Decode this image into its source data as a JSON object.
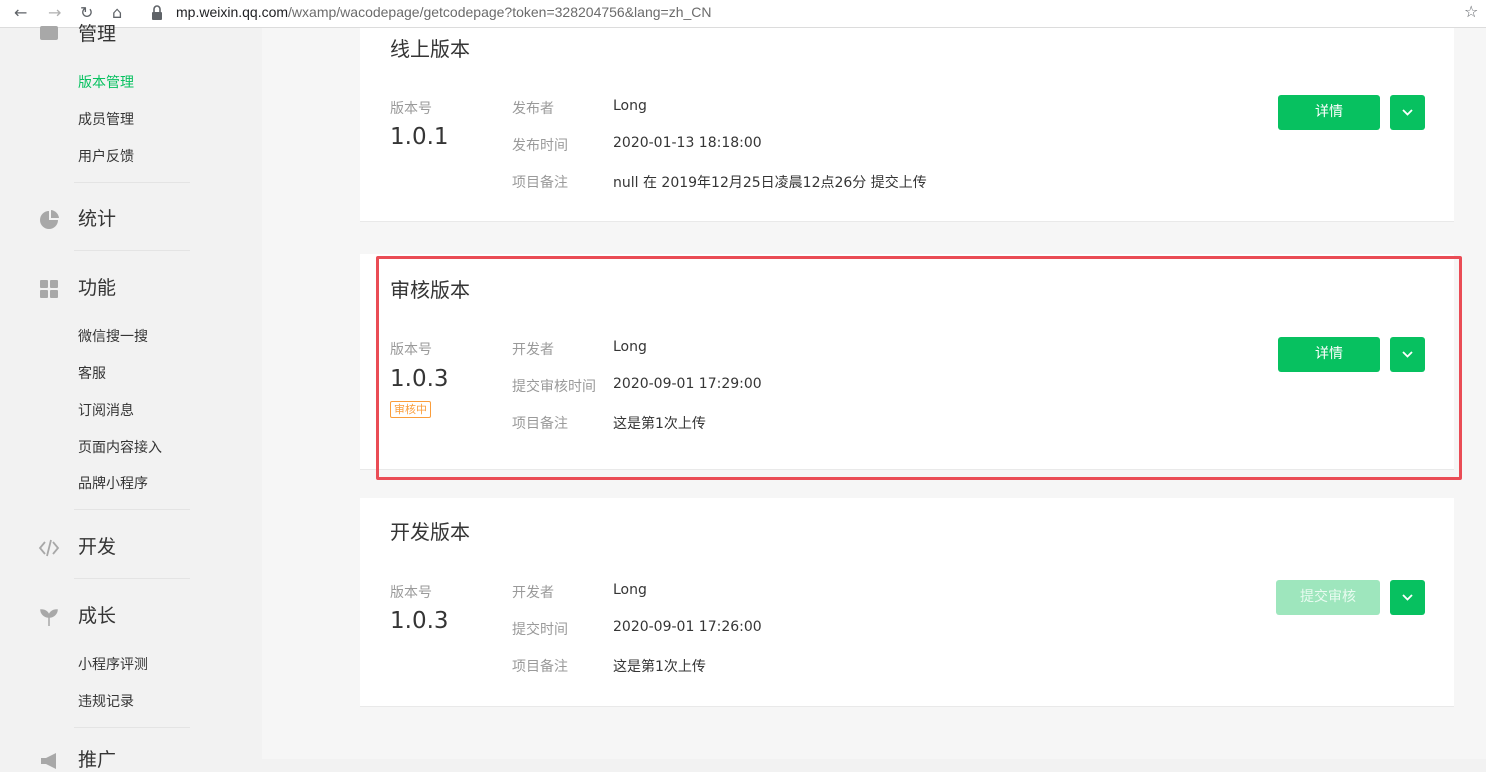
{
  "browser": {
    "url_host": "mp.weixin.qq.com",
    "url_path": "/wxamp/wacodepage/getcodepage?token=328204756&lang=zh_CN"
  },
  "sidebar": {
    "top_group": "管理",
    "manage_items": [
      "版本管理",
      "成员管理",
      "用户反馈"
    ],
    "stats": "统计",
    "features": "功能",
    "feature_items": [
      "微信搜一搜",
      "客服",
      "订阅消息",
      "页面内容接入",
      "品牌小程序"
    ],
    "dev": "开发",
    "growth": "成长",
    "growth_items": [
      "小程序评测",
      "违规记录"
    ],
    "bottom_partial": "推广"
  },
  "online": {
    "title": "线上版本",
    "version_label": "版本号",
    "version": "1.0.1",
    "meta": [
      {
        "key": "发布者",
        "value": "Long"
      },
      {
        "key": "发布时间",
        "value": "2020-01-13 18:18:00"
      },
      {
        "key": "项目备注",
        "value": "null 在 2019年12月25日凌晨12点26分 提交上传"
      }
    ],
    "button": "详情"
  },
  "review": {
    "title": "审核版本",
    "version_label": "版本号",
    "version": "1.0.3",
    "badge": "审核中",
    "meta": [
      {
        "key": "开发者",
        "value": "Long"
      },
      {
        "key": "提交审核时间",
        "value": "2020-09-01 17:29:00"
      },
      {
        "key": "项目备注",
        "value": "这是第1次上传"
      }
    ],
    "button": "详情"
  },
  "develop": {
    "title": "开发版本",
    "version_label": "版本号",
    "version": "1.0.3",
    "meta": [
      {
        "key": "开发者",
        "value": "Long"
      },
      {
        "key": "提交时间",
        "value": "2020-09-01 17:26:00"
      },
      {
        "key": "项目备注",
        "value": "这是第1次上传"
      }
    ],
    "button": "提交审核"
  },
  "colors": {
    "accent": "#07c160",
    "highlight": "#ea4c55",
    "badge": "#fa9d3b"
  }
}
